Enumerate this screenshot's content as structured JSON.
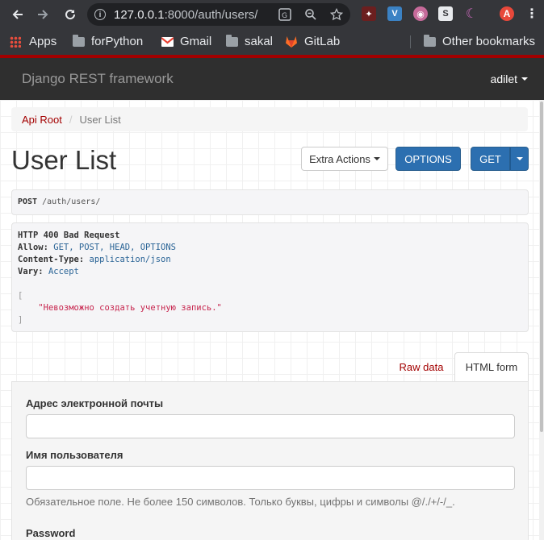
{
  "browser": {
    "url_host": "127.0.0.1",
    "url_rest": ":8000/auth/users/",
    "profile_initial": "A",
    "bookmarks": [
      {
        "label": "Apps",
        "icon": "apps-grid-icon"
      },
      {
        "label": "forPython",
        "icon": "folder-icon"
      },
      {
        "label": "Gmail",
        "icon": "gmail-icon"
      },
      {
        "label": "sakal",
        "icon": "folder-icon"
      },
      {
        "label": "GitLab",
        "icon": "gitlab-icon"
      }
    ],
    "other_bookmarks": "Other bookmarks"
  },
  "navbar": {
    "brand": "Django REST framework",
    "user": "adilet"
  },
  "breadcrumb": {
    "root": "Api Root",
    "current": "User List"
  },
  "page": {
    "title": "User List",
    "buttons": {
      "extra_actions": "Extra Actions",
      "options": "OPTIONS",
      "get": "GET"
    }
  },
  "request": {
    "method": "POST",
    "path": "/auth/users/"
  },
  "response": {
    "status": "HTTP 400 Bad Request",
    "headers": [
      {
        "key": "Allow:",
        "value": "GET, POST, HEAD, OPTIONS"
      },
      {
        "key": "Content-Type:",
        "value": "application/json"
      },
      {
        "key": "Vary:",
        "value": "Accept"
      }
    ],
    "open_bracket": "[",
    "body_string": "\"Невозможно создать учетную запись.\"",
    "close_bracket": "]"
  },
  "tabs": {
    "raw": "Raw data",
    "html": "HTML form"
  },
  "form": {
    "email_label": "Адрес электронной почты",
    "username_label": "Имя пользователя",
    "username_help": "Обязательное поле. Не более 150 символов. Только буквы, цифры и символы @/./+/-/_.",
    "password_label": "Password"
  },
  "colors": {
    "accent_red": "#a30000",
    "primary_blue": "#2c6fb0",
    "navbar_bg": "#2f2f2f",
    "chrome_bg": "#35363a"
  }
}
